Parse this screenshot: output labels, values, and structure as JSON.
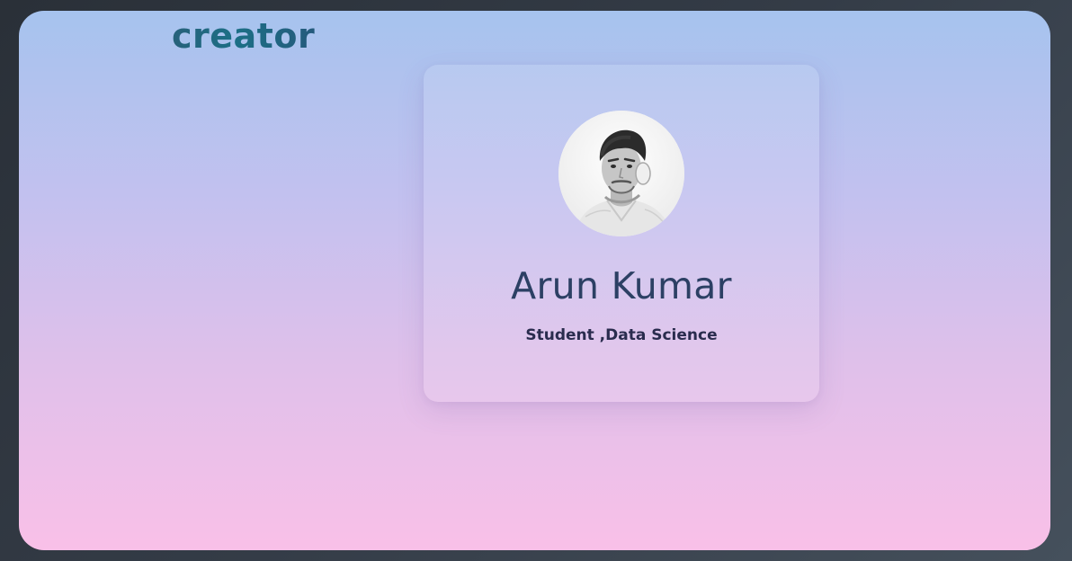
{
  "brand": {
    "logo_text": "creator"
  },
  "profile": {
    "name": "Arun Kumar",
    "role": "Student ,Data Science",
    "avatar_icon": "profile-photo"
  },
  "colors": {
    "name_text": "#2c4064",
    "role_text": "#2a2c4e",
    "logo_gradient_start": "#27617a",
    "logo_gradient_end": "#245a7c",
    "background_top": "#a6c3ee",
    "background_bottom": "#f9c0e8"
  }
}
